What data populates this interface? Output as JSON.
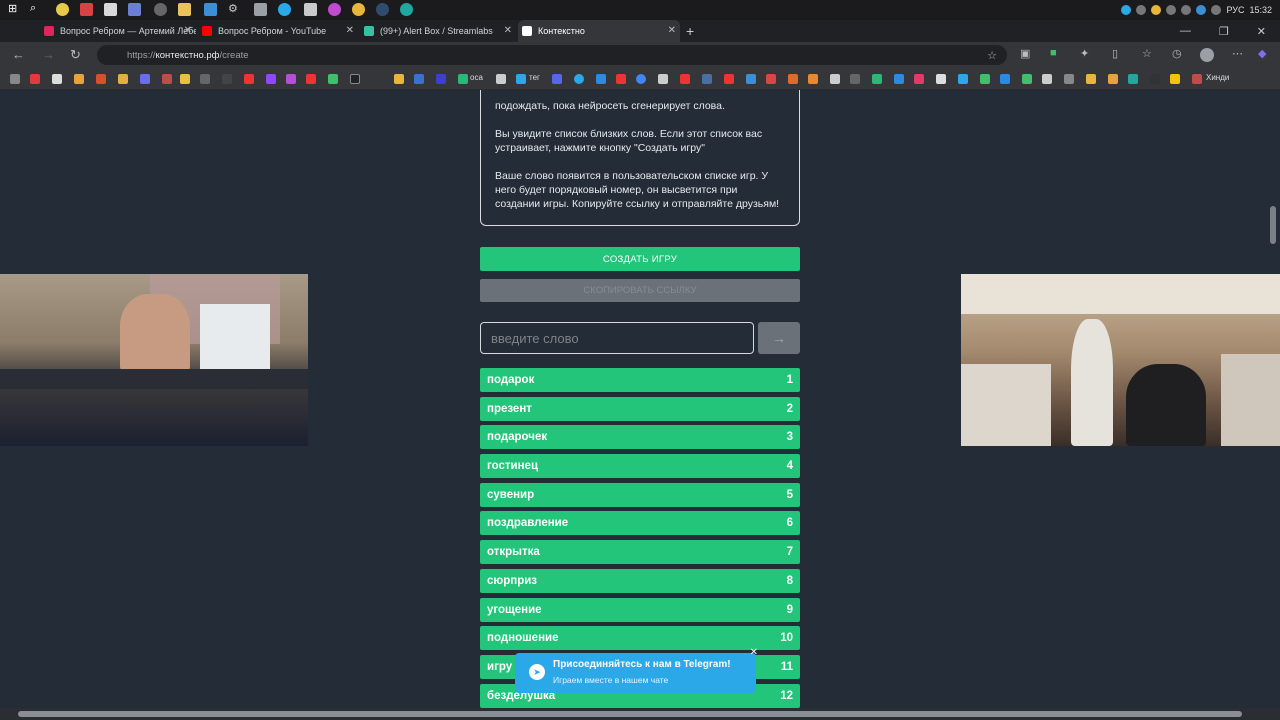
{
  "taskbar": {
    "lang": "РУС",
    "time": "15:32"
  },
  "tabs": [
    {
      "label": "Вопрос Ребром — Артемий Лебедев",
      "color": "#e0245e"
    },
    {
      "label": "Вопрос Ребром - YouTube",
      "color": "#ff0000"
    },
    {
      "label": "(99+) Alert Box / Streamlabs",
      "color": "#31c3a2"
    },
    {
      "label": "Контекстно",
      "color": "#ffffff"
    }
  ],
  "address": {
    "scheme": "https://",
    "host": "контекстно.рф",
    "path": "/create"
  },
  "bookmarks": {
    "osa": "оса",
    "teg": "тег",
    "hindi": "Хинди"
  },
  "info": {
    "p1": "подождать, пока нейросеть сгенерирует слова.",
    "p2": "Вы увидите список близких слов. Если этот список вас устраивает, нажмите кнопку \"Создать игру\"",
    "p3": "Ваше слово появится в пользовательском списке игр. У него будет порядковый номер, он высветится при создании игры. Копируйте ссылку и отправляйте друзьям!"
  },
  "buttons": {
    "create": "СОЗДАТЬ ИГРУ",
    "copy": "СКОПИРОВАТЬ ССЫЛКУ",
    "go": "→"
  },
  "input": {
    "placeholder": "введите слово",
    "value": ""
  },
  "words": [
    {
      "word": "подарок",
      "n": "1"
    },
    {
      "word": "презент",
      "n": "2"
    },
    {
      "word": "подарочек",
      "n": "3"
    },
    {
      "word": "гостинец",
      "n": "4"
    },
    {
      "word": "сувенир",
      "n": "5"
    },
    {
      "word": "поздравление",
      "n": "6"
    },
    {
      "word": "открытка",
      "n": "7"
    },
    {
      "word": "сюрприз",
      "n": "8"
    },
    {
      "word": "угощение",
      "n": "9"
    },
    {
      "word": "подношение",
      "n": "10"
    },
    {
      "word": "игру",
      "n": "11"
    },
    {
      "word": "безделушка",
      "n": "12"
    }
  ],
  "toast": {
    "title": "Присоединяйтесь к нам в Telegram!",
    "subtitle": "Играем вместе в нашем чате"
  }
}
